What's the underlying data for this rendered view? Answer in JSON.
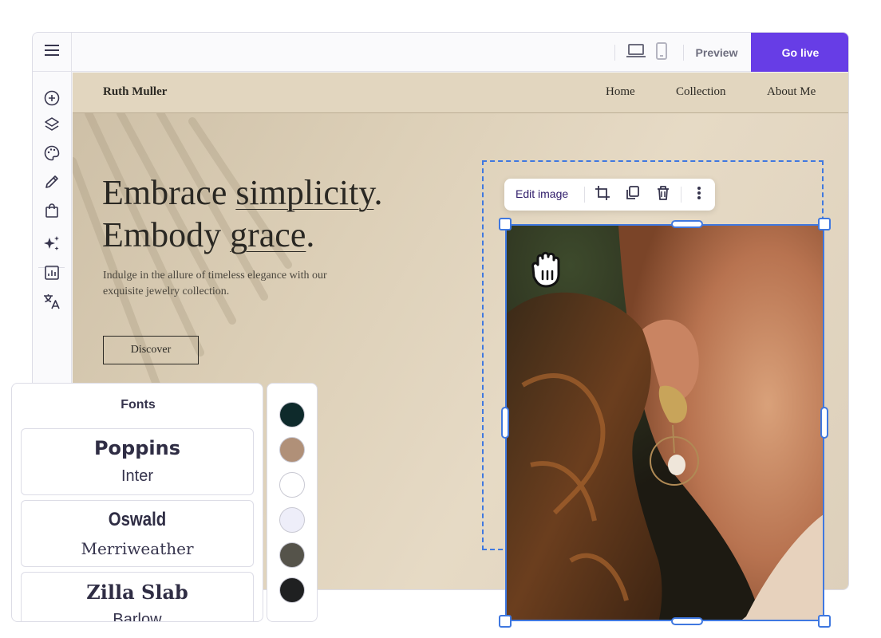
{
  "topbar": {
    "menu_icon": "hamburger-icon",
    "desktop_icon": "laptop-icon",
    "mobile_icon": "mobile-icon",
    "preview_label": "Preview",
    "go_live_label": "Go live",
    "accent_color": "#673de6"
  },
  "sidebar": {
    "items": [
      {
        "icon": "add-circle-icon"
      },
      {
        "icon": "layers-icon"
      },
      {
        "icon": "palette-icon"
      },
      {
        "icon": "pencil-icon"
      },
      {
        "icon": "shopping-bag-icon"
      },
      {
        "icon": "sparkles-icon"
      },
      {
        "icon": "analytics-icon"
      },
      {
        "icon": "translate-icon"
      }
    ]
  },
  "site": {
    "brand": "Ruth Muller",
    "nav": [
      "Home",
      "Collection",
      "About Me"
    ],
    "hero": {
      "line1_a": "Embrace ",
      "line1_b": "simplicity",
      "line1_c": ".",
      "line2_a": "Embody ",
      "line2_b": "grace",
      "line2_c": ".",
      "subtitle": "Indulge in the allure of timeless elegance with our exquisite jewelry collection.",
      "cta": "Discover"
    }
  },
  "image_toolbar": {
    "edit_label": "Edit image",
    "icons": [
      "crop-icon",
      "duplicate-icon",
      "trash-icon",
      "more-vertical-icon"
    ]
  },
  "fonts_panel": {
    "title": "Fonts",
    "pairs": [
      {
        "primary": "Poppins",
        "secondary": "Inter"
      },
      {
        "primary": "Oswald",
        "secondary": "Merriweather"
      },
      {
        "primary": "Zilla Slab",
        "secondary": "Barlow"
      }
    ]
  },
  "colors_panel": {
    "swatches": [
      "#0e2a2b",
      "#b09078",
      "#ffffff",
      "#eeeef9",
      "#55534a",
      "#1f2021"
    ]
  }
}
